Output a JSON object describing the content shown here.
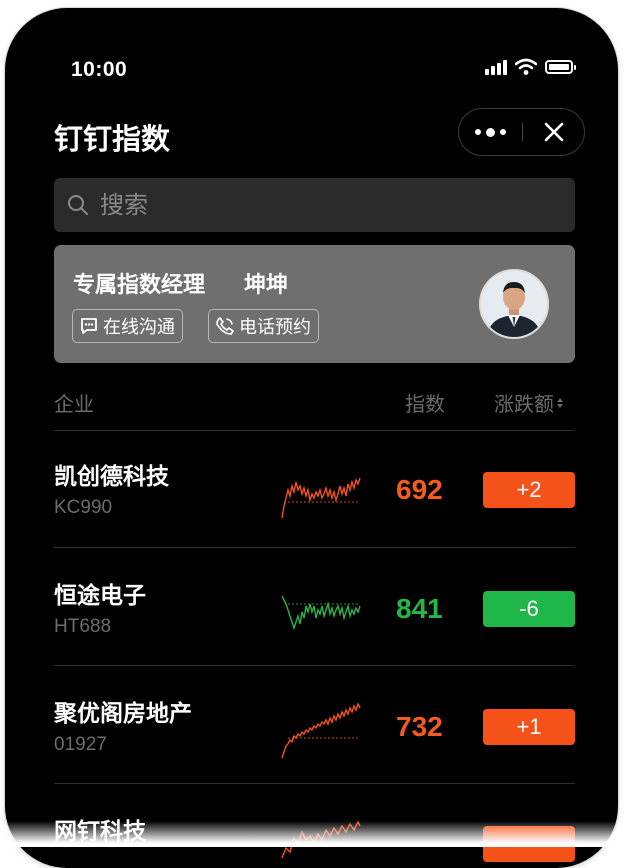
{
  "status_bar": {
    "time": "10:00",
    "icons": [
      "signal-icon",
      "wifi-icon",
      "battery-icon"
    ]
  },
  "header": {
    "title": "钉钉指数",
    "capsule_icons": [
      "more-icon",
      "close-icon"
    ]
  },
  "search": {
    "placeholder": "搜索"
  },
  "manager_card": {
    "label": "专属指数经理",
    "name": "坤坤",
    "buttons": [
      {
        "label": "在线沟通",
        "icon": "chat-icon"
      },
      {
        "label": "电话预约",
        "icon": "phone-icon"
      }
    ]
  },
  "table": {
    "headers": {
      "company": "企业",
      "index": "指数",
      "change": "涨跌额"
    },
    "sort_icon": "sort-icon",
    "rows": [
      {
        "name": "凯创德科技",
        "code": "KC990",
        "index": "692",
        "change": "+2",
        "trend": "up"
      },
      {
        "name": "恒途电子",
        "code": "HT688",
        "index": "841",
        "change": "-6",
        "trend": "down"
      },
      {
        "name": "聚优阁房地产",
        "code": "01927",
        "index": "732",
        "change": "+1",
        "trend": "up"
      },
      {
        "name": "网钉科技",
        "code": "",
        "index": "",
        "change": "",
        "trend": "up"
      }
    ]
  },
  "colors": {
    "up": "#f5521a",
    "down": "#1fb64a",
    "background": "#000000",
    "card": "#6f6f6f",
    "search": "#2b2b2b"
  }
}
